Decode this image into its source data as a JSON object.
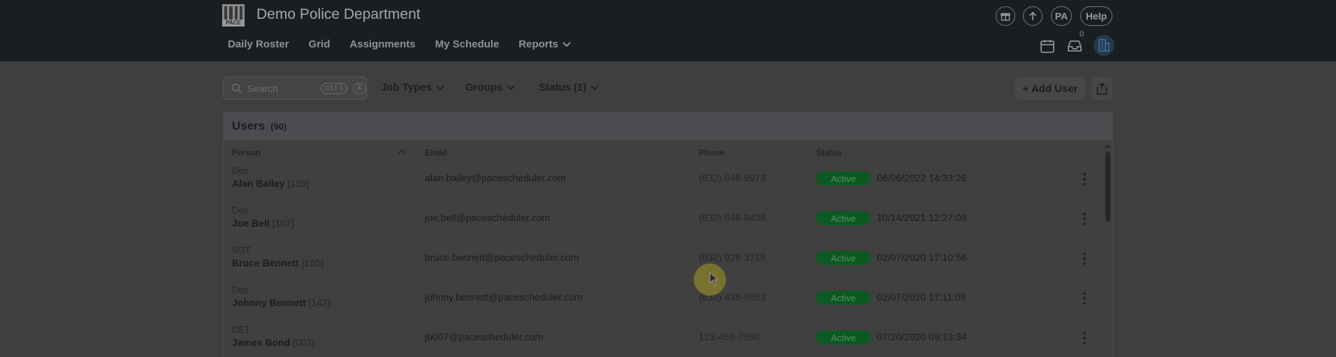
{
  "header": {
    "logo_text": "PACE",
    "org_name": "Demo Police Department",
    "nav": [
      {
        "label": "Daily Roster"
      },
      {
        "label": "Grid"
      },
      {
        "label": "Assignments"
      },
      {
        "label": "My Schedule"
      },
      {
        "label": "Reports",
        "has_dropdown": true
      }
    ],
    "avatar_initials": "PA",
    "help_label": "Help",
    "inbox_count": "0"
  },
  "toolbar": {
    "search_placeholder": "Search",
    "shortcut_key1": "ctrl",
    "shortcut_key2": "k",
    "filters": [
      {
        "label": "Job Types"
      },
      {
        "label": "Groups"
      },
      {
        "label": "Status (1)"
      }
    ],
    "add_user_label": "+ Add User"
  },
  "users_table": {
    "title": "Users",
    "count": "(90)",
    "columns": [
      "Person",
      "Email",
      "Phone",
      "Status"
    ],
    "rows": [
      {
        "role": "Dep",
        "name": "Alan Bailey",
        "id": "[139]",
        "email": "alan.bailey@pacescheduler.com",
        "phone": "(632) 648-9973",
        "status": "Active",
        "timestamp": "06/06/2022 14:33:26"
      },
      {
        "role": "Dep",
        "name": "Joe Bell",
        "id": "[107]",
        "email": "joe.bell@pacescheduler.com",
        "phone": "(632) 646-8438",
        "status": "Active",
        "timestamp": "10/14/2021 12:27:08"
      },
      {
        "role": "SGT",
        "name": "Bruce Bennett",
        "id": "[105]",
        "email": "bruce.bennett@pacescheduler.com",
        "phone": "(632) 928-3719",
        "status": "Active",
        "timestamp": "02/07/2020 17:10:56"
      },
      {
        "role": "Dep",
        "name": "Johnny Bennett",
        "id": "[142]",
        "email": "johnny.bennett@pacescheduler.com",
        "phone": "(632) 438-6053",
        "status": "Active",
        "timestamp": "02/07/2020 17:11:08"
      },
      {
        "role": "DET",
        "name": "James Bond",
        "id": "[007]",
        "email": "jb007@pacescheduler.com",
        "phone": "123-456-7890",
        "status": "Active",
        "timestamp": "07/20/2020 09:13:34"
      }
    ]
  },
  "colors": {
    "topbar_bg": "#1b1e21",
    "overlay_bg": "#3f3f3f",
    "status_active": "#0c5a22",
    "accent_building": "#27384a"
  },
  "icons": [
    "gift-icon",
    "arrow-up-icon",
    "calendar-icon",
    "inbox-icon",
    "building-icon",
    "search-icon",
    "chevron-down-icon",
    "share-icon",
    "kebab-icon",
    "sort-caret-icon",
    "cursor-icon"
  ]
}
